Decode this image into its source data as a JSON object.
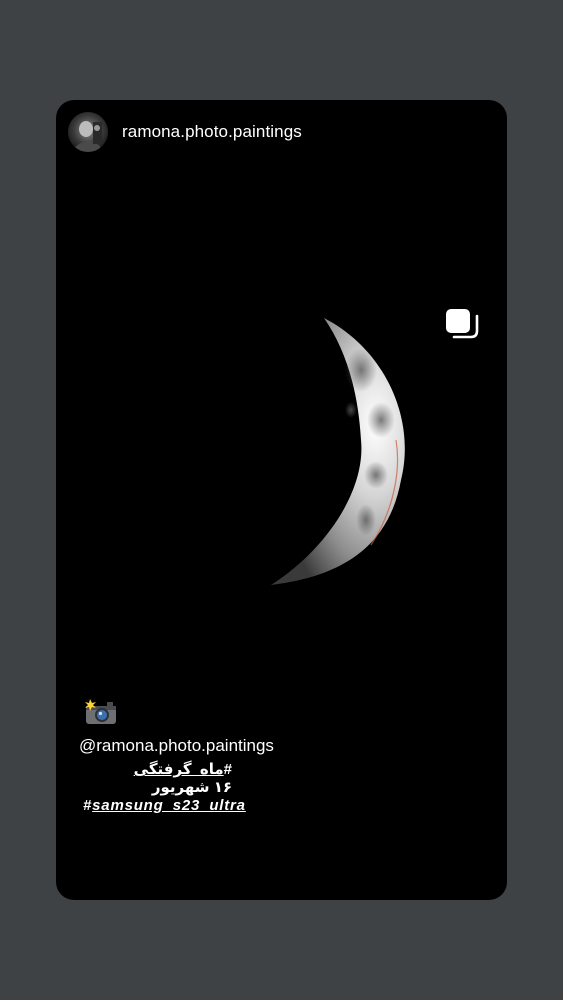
{
  "post": {
    "username": "ramona.photo.paintings",
    "media_icon": "multiple-images-icon",
    "image_subject": "crescent-moon-photo"
  },
  "caption": {
    "camera_icon": "camera-with-flash-emoji",
    "mention": "@ramona.photo.paintings",
    "hashtag_fa_symbol": "#",
    "hashtag_fa": "ماه_گرفتگی",
    "date_fa": "۱۶ شهریور",
    "hashtag_en_symbol": "#",
    "hashtag_en": "samsung_s23_ultra"
  },
  "colors": {
    "page_background": "#3f4245",
    "card_background": "#000000",
    "text": "#ffffff"
  }
}
